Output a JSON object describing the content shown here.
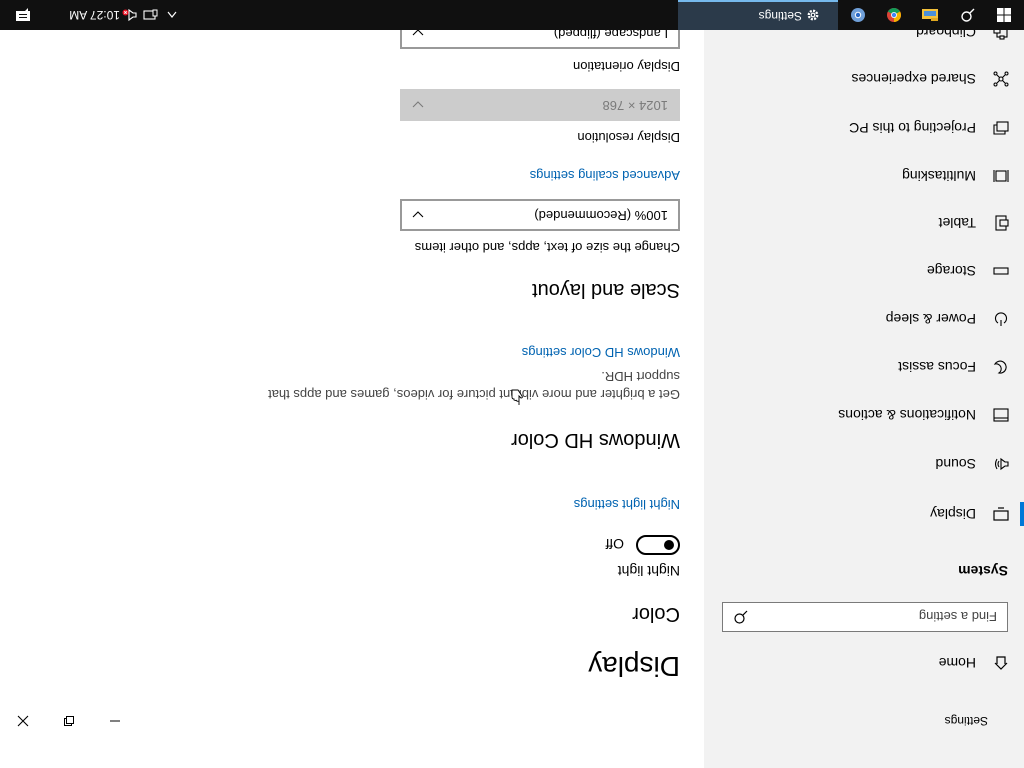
{
  "window": {
    "title": "Settings"
  },
  "sidebar": {
    "home_label": "Home",
    "search_placeholder": "Find a setting",
    "section_title": "System",
    "items": [
      {
        "label": "Display",
        "icon": "monitor-icon",
        "active": true
      },
      {
        "label": "Sound",
        "icon": "speaker-icon"
      },
      {
        "label": "Notifications & actions",
        "icon": "notification-icon"
      },
      {
        "label": "Focus assist",
        "icon": "moon-icon"
      },
      {
        "label": "Power & sleep",
        "icon": "power-icon"
      },
      {
        "label": "Storage",
        "icon": "storage-icon"
      },
      {
        "label": "Tablet",
        "icon": "tablet-icon"
      },
      {
        "label": "Multitasking",
        "icon": "multitasking-icon"
      },
      {
        "label": "Projecting to this PC",
        "icon": "projecting-icon"
      },
      {
        "label": "Shared experiences",
        "icon": "shared-icon"
      },
      {
        "label": "Clipboard",
        "icon": "clipboard-icon"
      }
    ]
  },
  "content": {
    "title": "Display",
    "color": {
      "heading": "Color",
      "night_light_label": "Night light",
      "night_light_state": "Off",
      "night_light_link": "Night light settings"
    },
    "hd_color": {
      "heading": "Windows HD Color",
      "description": "Get a brighter and more vibrant picture for videos, games and apps that support HDR.",
      "link": "Windows HD Color settings"
    },
    "scale": {
      "heading": "Scale and layout",
      "size_label": "Change the size of text, apps, and other items",
      "size_value": "100% (Recommended)",
      "advanced_link": "Advanced scaling settings",
      "resolution_label": "Display resolution",
      "resolution_value": "1024 × 768",
      "orientation_label": "Display orientation",
      "orientation_value": "Landscape (flipped)"
    }
  },
  "taskbar": {
    "active_app": "Settings",
    "clock": "10:27 AM"
  },
  "colors": {
    "accent": "#0078d7",
    "link": "#0063b1",
    "sidebar_bg": "#f2f2f2",
    "taskbar_bg": "#101010"
  }
}
